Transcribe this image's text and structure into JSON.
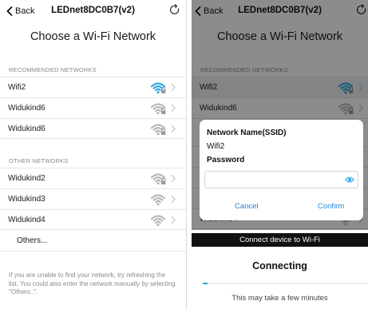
{
  "left": {
    "nav": {
      "back_label": "Back",
      "title": "LEDnet8DC0B7(v2)"
    },
    "page_title": "Choose a Wi-Fi Network",
    "recommended_header": "RECOMMENDED NETWORKS",
    "recommended": [
      {
        "label": "Wifi2",
        "signal_icon": "wifi-locked-icon",
        "signal_color": "#33a9e0"
      },
      {
        "label": "Widukind6",
        "signal_icon": "wifi-locked-icon",
        "signal_color": "#b8b8b8"
      },
      {
        "label": "Widukind6",
        "signal_icon": "wifi-locked-icon",
        "signal_color": "#b8b8b8"
      }
    ],
    "other_header": "OTHER NETWORKS",
    "other": [
      {
        "label": "Widukind2",
        "signal_icon": "wifi-locked-icon",
        "signal_color": "#b8b8b8"
      },
      {
        "label": "Widukind3",
        "signal_icon": "wifi-open-icon",
        "signal_color": "#b8b8b8"
      },
      {
        "label": "Widukind4",
        "signal_icon": "wifi-open-icon",
        "signal_color": "#b8b8b8"
      }
    ],
    "others_label": "Others...",
    "footnote": "If you are unable to find your network, try refreshing the list. You could also enter the network manually by selecting \"Others..\"."
  },
  "right": {
    "nav": {
      "back_label": "Back",
      "title": "LEDnet8DC0B7(v2)"
    },
    "page_title": "Choose a Wi-Fi Network",
    "recommended_header": "RECOMMENDED NETWORKS",
    "rows_visible": [
      "Wifi2",
      "Widukind6",
      "W",
      "OT",
      "W",
      "W",
      "Widukind4"
    ],
    "dialog": {
      "ssid_label": "Network Name(SSID)",
      "ssid_value": "Wifi2",
      "password_label": "Password",
      "password_value": "",
      "cancel_label": "Cancel",
      "confirm_label": "Confirm"
    },
    "sheet": {
      "bar_title": "Connect device to Wi-Fi",
      "status": "Connecting",
      "progress_fraction": 0.03,
      "hint": "This may take a few minutes"
    }
  },
  "colors": {
    "accent_blue": "#2a7fd4",
    "wifi_active": "#33a9e0",
    "wifi_inactive": "#b8b8b8",
    "progress": "#2aa5e0"
  }
}
